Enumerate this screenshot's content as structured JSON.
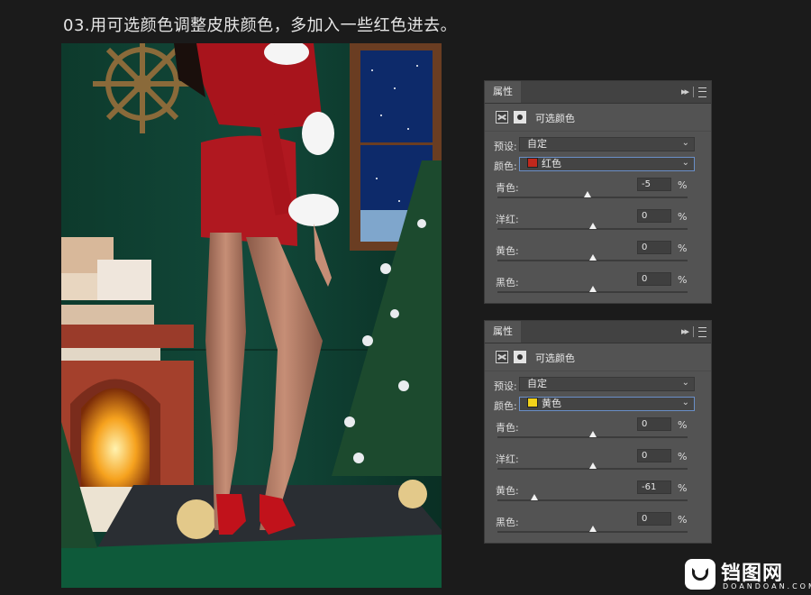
{
  "heading": "03.用可选颜色调整皮肤颜色，多加入一些红色进去。",
  "colors": {
    "red_swatch": "#c0281c",
    "yellow_swatch": "#f2d21a"
  },
  "panels": [
    {
      "tab": "属性",
      "collapse_icon": "double-chevron-right-icon",
      "menu_icon": "hamburger-menu-icon",
      "adjustment_title": "可选颜色",
      "preset_label": "预设:",
      "preset_value": "自定",
      "color_label": "颜色:",
      "color_value": "红色",
      "sliders": [
        {
          "label": "青色:",
          "value": "-5",
          "unit": "%",
          "fraction": 0.475
        },
        {
          "label": "洋红:",
          "value": "0",
          "unit": "%",
          "fraction": 0.5
        },
        {
          "label": "黄色:",
          "value": "0",
          "unit": "%",
          "fraction": 0.5
        },
        {
          "label": "黑色:",
          "value": "0",
          "unit": "%",
          "fraction": 0.5
        }
      ]
    },
    {
      "tab": "属性",
      "collapse_icon": "double-chevron-right-icon",
      "menu_icon": "hamburger-menu-icon",
      "adjustment_title": "可选颜色",
      "preset_label": "预设:",
      "preset_value": "自定",
      "color_label": "颜色:",
      "color_value": "黄色",
      "sliders": [
        {
          "label": "青色:",
          "value": "0",
          "unit": "%",
          "fraction": 0.5
        },
        {
          "label": "洋红:",
          "value": "0",
          "unit": "%",
          "fraction": 0.5
        },
        {
          "label": "黄色:",
          "value": "-61",
          "unit": "%",
          "fraction": 0.195
        },
        {
          "label": "黑色:",
          "value": "0",
          "unit": "%",
          "fraction": 0.5
        }
      ]
    }
  ],
  "watermark": {
    "brand": "铛图网",
    "sub": "DOANDOAN.COM"
  }
}
